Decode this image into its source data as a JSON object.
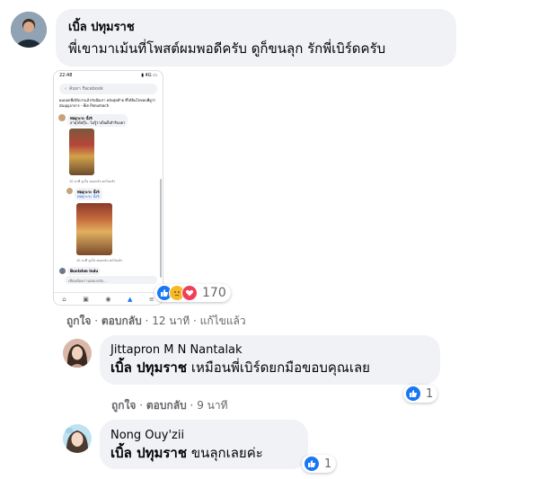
{
  "top_comment": {
    "author": "เบิ้ล ปทุมราช",
    "text": "พี่เขามาเม้นที่โพสต์ผมพอดีครับ ดูก็ขนลุก รักพี่เบิร์ดครับ",
    "reaction_count": "170",
    "reactions": [
      "like-icon",
      "sad-icon",
      "love-icon"
    ],
    "actions": {
      "like": "ถูกใจ",
      "reply": "ตอบกลับ",
      "time": "12 นาที",
      "edited": "แก้ไขแล้ว"
    },
    "screenshot": {
      "status_time": "22:48",
      "status_signal": "▮ 4G ▭",
      "search_placeholder": "ค้นหา Facebook",
      "post_title": "ผมบอกพี่เบิร์ดว่าแล้วกับมือเก่า หลังสุดท้าย ที่ได้ยินใจขอบพี่ดูว่ามันบุญอาจาร - Bie Panumach",
      "c1_name": "พ่อยุกะระ นั้งจิ",
      "c1_text": "สาธุได้สกุ๊ง.. ไม่รู้ว่าเป็นตั้งสำรีบอยา",
      "c1_actions": "10 นาที   ถูกใจ   ตอบกลับ   ตกไปแล้ว",
      "c2_name": "พ่อยุกะระ นั้งจิ",
      "c2_mention": "พ่อยุกะระ นั้งจิ",
      "c2_actions": "10 นาที   ถูกใจ   ตอบกลับ   ตกไปแล้ว",
      "c3_name": "Bunlahm Indu",
      "composer_placeholder": "เขียนข้อความตอบกลับ..."
    }
  },
  "replies": [
    {
      "author": "Jittapron M N Nantalak",
      "mention": "เบิ้ล ปทุมราช",
      "text": "เหมือนพี่เบิร์ดยกมือขอบคุณเลย",
      "reaction_count": "1",
      "actions": {
        "like": "ถูกใจ",
        "reply": "ตอบกลับ",
        "time": "9 นาที"
      }
    },
    {
      "author": "Nong Ouy'zii",
      "mention": "เบิ้ล ปทุมราช",
      "text": "ขนลุกเลยค่ะ",
      "reaction_count": "1"
    }
  ],
  "colors": {
    "like": "#1877f2",
    "sad": "#f7b928",
    "love": "#f33e58",
    "bubble": "#f0f2f5",
    "meta": "#65676b"
  }
}
